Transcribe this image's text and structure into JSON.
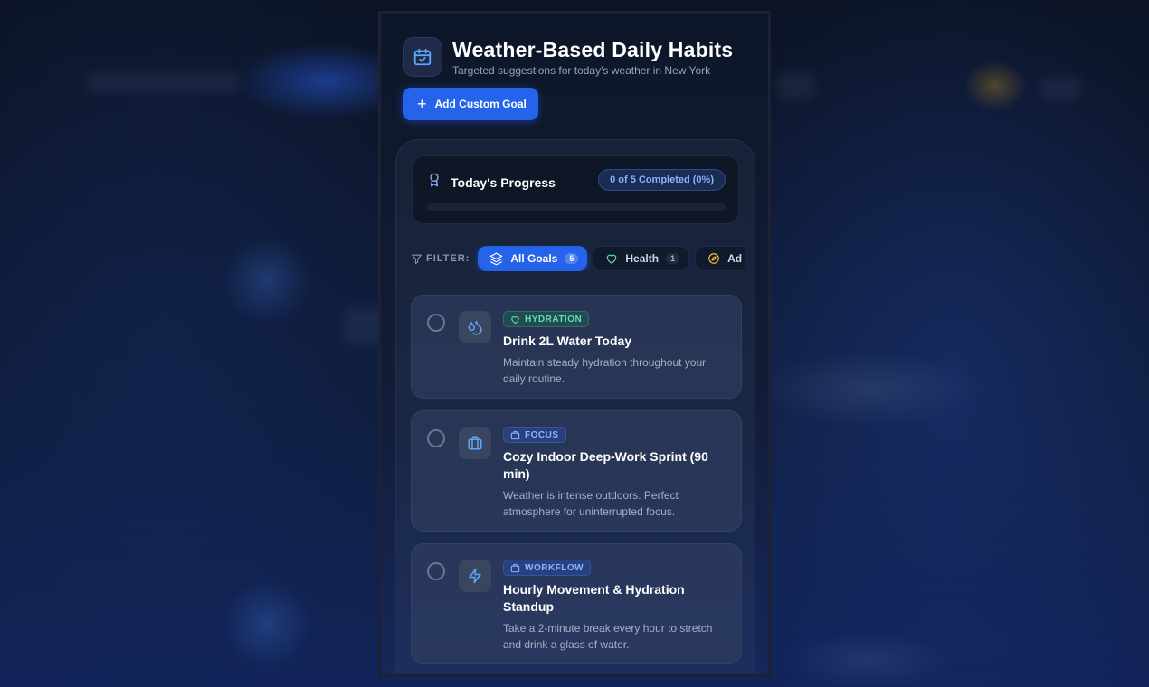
{
  "header": {
    "title": "Weather-Based Daily Habits",
    "subtitle": "Targeted suggestions for today's weather in New York",
    "icon": "calendar-check-icon"
  },
  "actions": {
    "add_goal_label": "Add Custom Goal"
  },
  "progress": {
    "title": "Today's Progress",
    "icon": "award-icon",
    "summary": "0 of 5 Completed (0%)",
    "completed": 0,
    "total": 5,
    "fraction": 0
  },
  "filter": {
    "label": "FILTER:",
    "chips": [
      {
        "label": "All Goals",
        "count": "5",
        "icon": "layers-icon",
        "active": true
      },
      {
        "label": "Health",
        "count": "1",
        "icon": "heart-icon",
        "active": false
      },
      {
        "label": "Ad",
        "count": "",
        "icon": "compass-icon",
        "active": false
      }
    ]
  },
  "goals": [
    {
      "tag": "HYDRATION",
      "tag_icon": "heart-icon",
      "icon": "droplets-icon",
      "title": "Drink 2L Water Today",
      "description": "Maintain steady hydration throughout your daily routine.",
      "completed": false
    },
    {
      "tag": "FOCUS",
      "tag_icon": "briefcase-icon",
      "icon": "briefcase-icon",
      "title": "Cozy Indoor Deep-Work Sprint (90 min)",
      "description": "Weather is intense outdoors. Perfect atmosphere for uninterrupted focus.",
      "completed": false
    },
    {
      "tag": "WORKFLOW",
      "tag_icon": "briefcase-icon",
      "icon": "zap-icon",
      "title": "Hourly Movement & Hydration Standup",
      "description": "Take a 2-minute break every hour to stretch and drink a glass of water.",
      "completed": false
    }
  ],
  "colors": {
    "accent": "#2563eb",
    "health_tag": "#5ee0a6",
    "focus_tag": "#8cb3ff"
  }
}
